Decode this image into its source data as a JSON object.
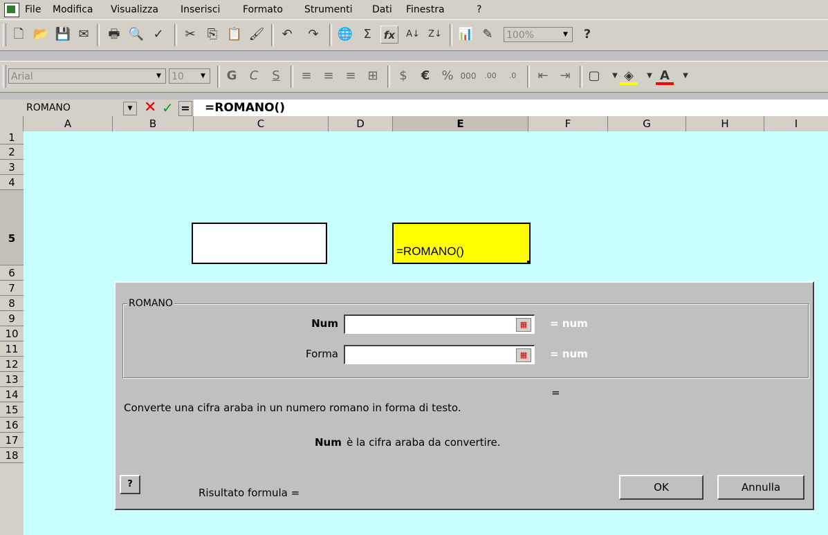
{
  "menu": [
    "File",
    "Modifica",
    "Visualizza",
    "Inserisci",
    "Formato",
    "Strumenti",
    "Dati",
    "Finestra",
    "?"
  ],
  "toolbar": {
    "zoom": "100%",
    "font": "Arial",
    "size": "10",
    "icons": [
      "new-icon",
      "open-icon",
      "save-icon",
      "print-icon",
      "print-preview-icon",
      "spelling-icon",
      "cut-icon",
      "copy-icon",
      "paste-icon",
      "format-painter-icon",
      "undo-icon",
      "redo-icon",
      "hyperlink-icon",
      "autosum-icon",
      "function-icon",
      "sort-asc-icon",
      "sort-desc-icon",
      "chart-icon",
      "drawing-icon",
      "help-icon"
    ]
  },
  "formula_bar": {
    "name_box": "ROMANO",
    "cancel_glyph": "✕",
    "enter_glyph": "✓",
    "equals_glyph": "=",
    "content": "=ROMANO()"
  },
  "columns": [
    "A",
    "B",
    "C",
    "D",
    "E",
    "F",
    "G",
    "H",
    "I"
  ],
  "rows": [
    "1",
    "2",
    "3",
    "4",
    "5",
    "6",
    "7",
    "8",
    "9",
    "10",
    "11",
    "12",
    "13",
    "14",
    "15",
    "16",
    "17",
    "18"
  ],
  "cell_e5": "=ROMANO()",
  "dialog": {
    "group_title": "ROMANO",
    "fields": [
      {
        "label": "Num",
        "value": "",
        "result": "= num"
      },
      {
        "label": "Forma",
        "value": "",
        "result": "= num"
      }
    ],
    "equals": "=",
    "description": "Converte una cifra araba in un numero romano in forma di testo.",
    "arg_name": "Num",
    "arg_desc": "è la cifra araba da convertire.",
    "result_label": "Risultato formula =",
    "ok": "OK",
    "cancel": "Annulla"
  }
}
